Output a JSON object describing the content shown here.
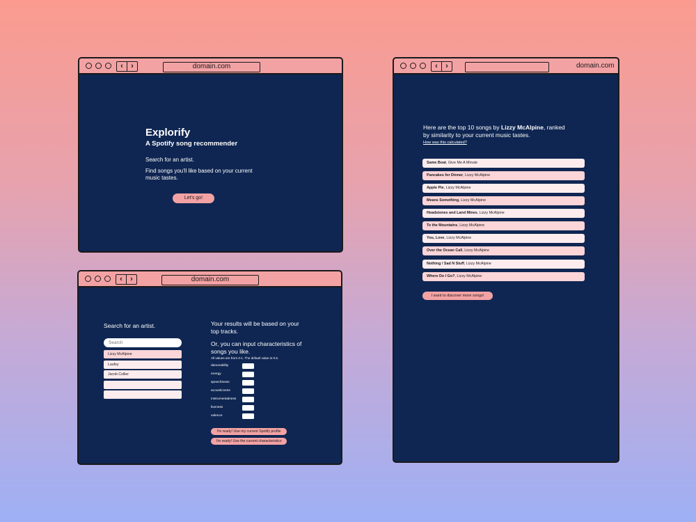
{
  "window1": {
    "url": "domain.com",
    "app_title": "Explorify",
    "subtitle": "A Spotify song recommender",
    "line1": "Search for an artist.",
    "line2a": "Find songs you'll like based on your current",
    "line2b": "music tastes.",
    "cta": "Let's go!"
  },
  "window2": {
    "url": "domain.com",
    "search_heading": "Search for an artist.",
    "search_placeholder": "Search",
    "results": [
      "Lizzy McAlpine",
      "Laufey",
      "Jacob Collier",
      "",
      ""
    ],
    "right_heading_a": "Your results will be based on your",
    "right_heading_b": "top tracks.",
    "or_heading_a": "Or, you can input characteristics of",
    "or_heading_b": "songs you like.",
    "note": "All values are from 0-1. The default value is 0.5.",
    "characteristics": [
      "danceability",
      "energy",
      "speechiness",
      "acousticness",
      "instrumentalness",
      "liveness",
      "valence"
    ],
    "btn_profile": "I'm ready! Use my current Spotify profile",
    "btn_characteristics": "I'm ready! Use the current characteristics"
  },
  "window3": {
    "url": "domain.com",
    "intro_pre": "Here are the top 10 songs by ",
    "intro_artist": "Lizzy McAlpine",
    "intro_post": ", ranked",
    "intro_line2": "by similarity to your current music tastes.",
    "how_link": "How was this calculated?",
    "songs": [
      {
        "title": "Same Boat",
        "artist": ", Give Me A Minute"
      },
      {
        "title": "Pancakes for Dinner",
        "artist": ", Lizzy McAlpine"
      },
      {
        "title": "Apple Pie",
        "artist": ", Lizzy McAlpine"
      },
      {
        "title": "Means Something",
        "artist": ", Lizzy McAlpine"
      },
      {
        "title": "Headstones and Land Mines",
        "artist": ", Lizzy McAlpine"
      },
      {
        "title": "To the Mountains",
        "artist": ", Lizzy McAlpine"
      },
      {
        "title": "You, Love",
        "artist": ", Lizzy McAlpine"
      },
      {
        "title": "Over the Ocean Call",
        "artist": ", Lizzy McAlpine"
      },
      {
        "title": "Nothing / Sad N Stuff",
        "artist": ", Lizzy McAlpine"
      },
      {
        "title": "Where Do I Go?",
        "artist": ", Lizzy McAlpine"
      }
    ],
    "more_button": "I want to discover more songs!"
  },
  "colors": {
    "window_bg": "#0f2652",
    "titlebar": "#f3a2a4",
    "accent_pink": "#f3a2a4",
    "row_light": "#fdecee",
    "row_pink": "#fcd5d8"
  }
}
